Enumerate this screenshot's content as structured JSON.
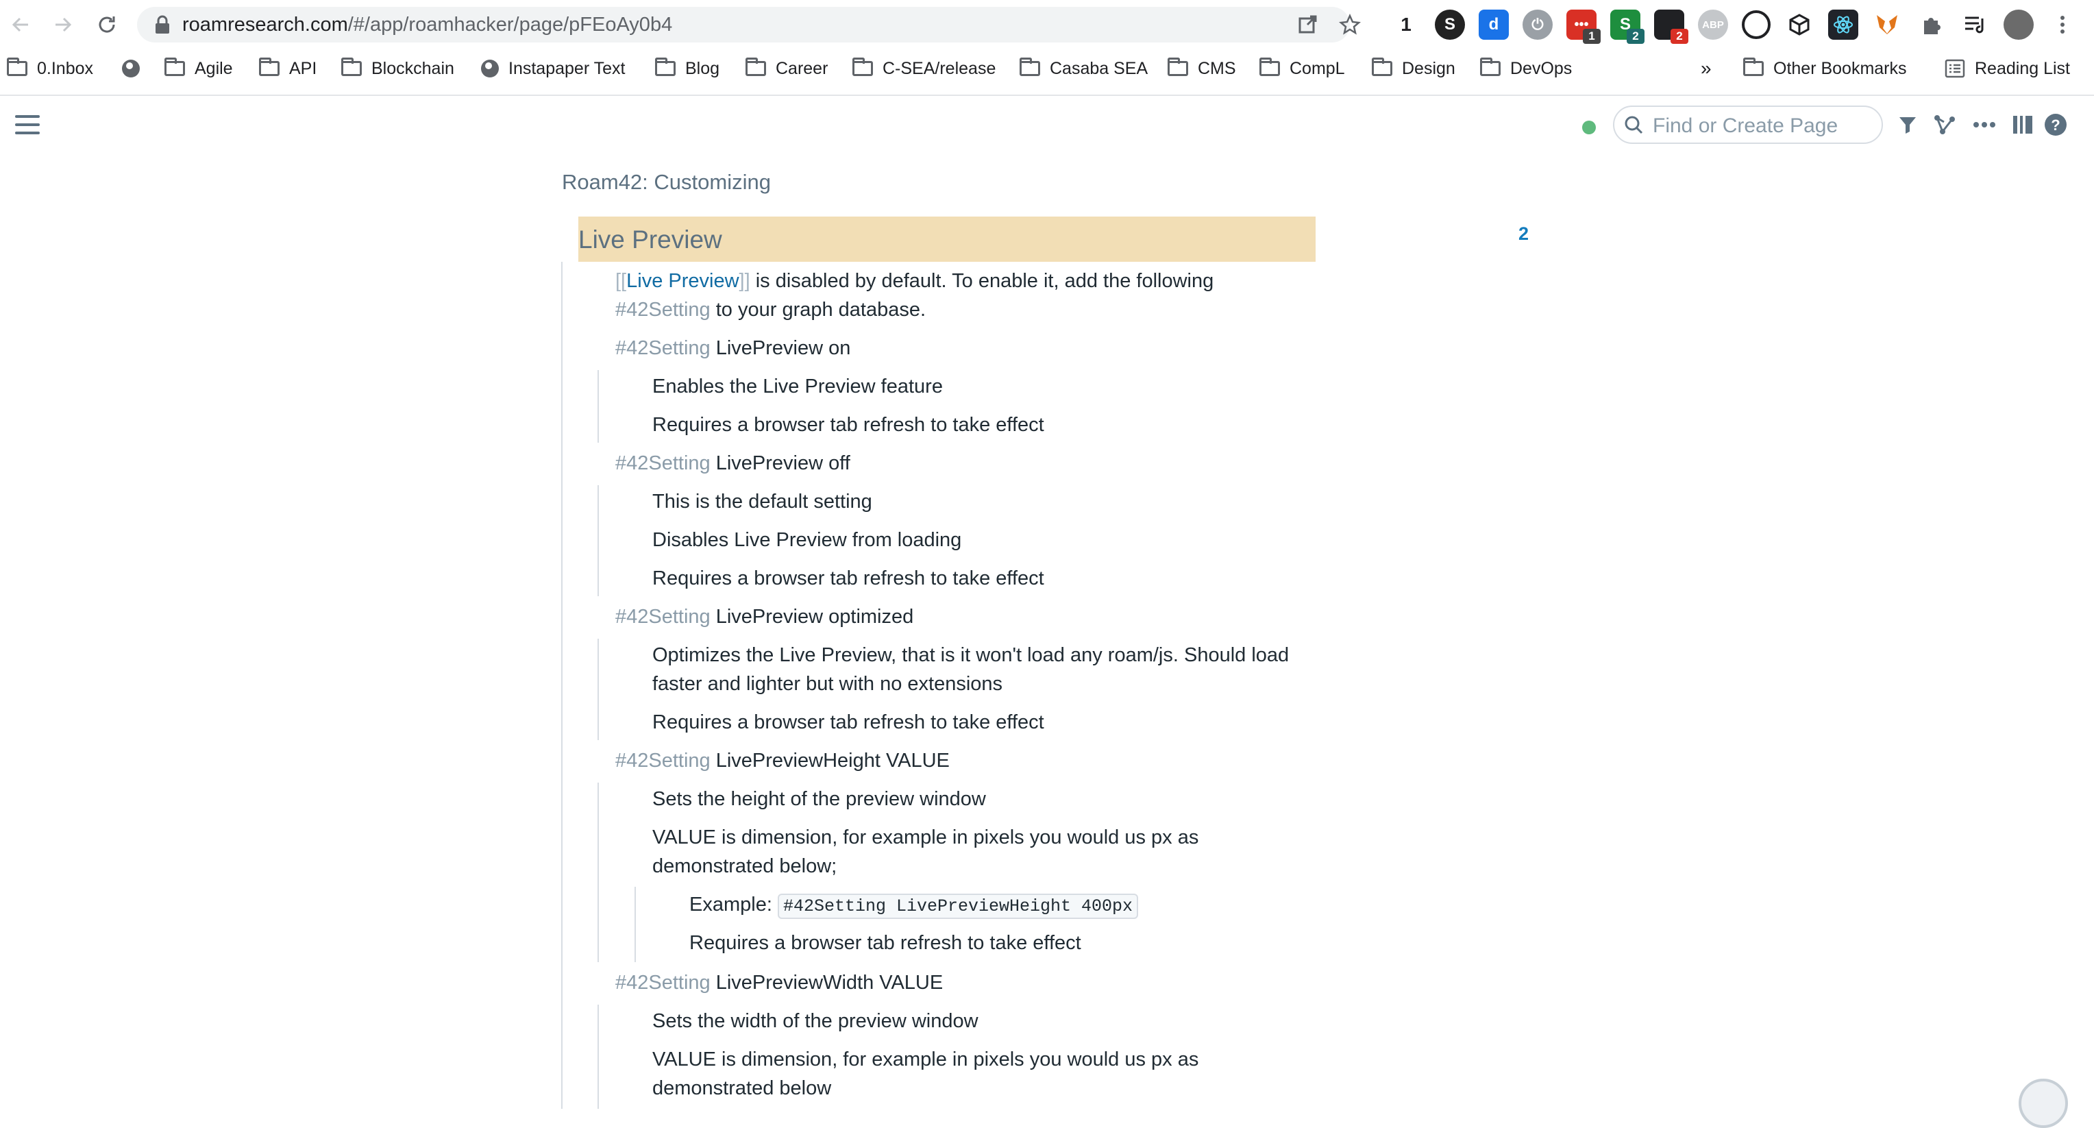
{
  "browser": {
    "url_host": "roamresearch.com",
    "url_path": "/#/app/roamhacker/page/pFEoAy0b4",
    "extensions": [
      {
        "name": "1password-ext",
        "text": "1",
        "badge": ""
      },
      {
        "name": "s-ext",
        "text": "S",
        "badge": ""
      },
      {
        "name": "d-ext",
        "text": "d",
        "badge": ""
      },
      {
        "name": "power-ext",
        "text": "",
        "badge": ""
      },
      {
        "name": "dots-ext",
        "text": "",
        "badge": "1"
      },
      {
        "name": "s2-ext",
        "text": "S",
        "badge": "2"
      },
      {
        "name": "dark-ext",
        "text": "",
        "badge": "2"
      },
      {
        "name": "abp-ext",
        "text": "ABP",
        "badge": ""
      }
    ],
    "bookmarks": [
      {
        "label": "0.Inbox",
        "icon": "folder"
      },
      {
        "label": "",
        "icon": "globe"
      },
      {
        "label": "Agile",
        "icon": "folder"
      },
      {
        "label": "API",
        "icon": "folder"
      },
      {
        "label": "Blockchain",
        "icon": "folder"
      },
      {
        "label": "Instapaper Text",
        "icon": "globe"
      },
      {
        "label": "Blog",
        "icon": "folder"
      },
      {
        "label": "Career",
        "icon": "folder"
      },
      {
        "label": "C-SEA/release",
        "icon": "folder"
      },
      {
        "label": "Casaba SEA",
        "icon": "folder"
      },
      {
        "label": "CMS",
        "icon": "folder"
      },
      {
        "label": "CompL",
        "icon": "folder"
      },
      {
        "label": "Design",
        "icon": "folder"
      },
      {
        "label": "DevOps",
        "icon": "folder"
      }
    ],
    "overflow": "»",
    "other_bookmarks": "Other Bookmarks",
    "reading_list": "Reading List"
  },
  "app": {
    "search_placeholder": "Find or Create Page"
  },
  "page": {
    "breadcrumb": "Roam42: Customizing",
    "title": "Live Preview",
    "reference_count": "2",
    "blocks": [
      {
        "text_pref_open": "[[",
        "text_pref": "Live Preview",
        "text_pref_close": "]]",
        "text_after": " is disabled by default. To enable it, add the following",
        "line2_tag": "#42Setting",
        "line2_rest": " to your graph database."
      },
      {
        "tag": "#42Setting",
        "rest": " LivePreview on"
      },
      {
        "text": "Enables the Live Preview feature"
      },
      {
        "text": "Requires a browser tab refresh to take effect"
      },
      {
        "tag": "#42Setting",
        "rest": " LivePreview off"
      },
      {
        "text": "This is the default setting"
      },
      {
        "text": "Disables Live Preview from loading"
      },
      {
        "text": "Requires a browser tab refresh to take effect"
      },
      {
        "tag": "#42Setting",
        "rest": " LivePreview optimized"
      },
      {
        "text": "Optimizes the Live Preview, that is it won't load any roam/js. Should load",
        "line2": "faster and lighter but with no extensions"
      },
      {
        "text": "Requires a browser tab refresh to take effect"
      },
      {
        "tag": "#42Setting",
        "rest": " LivePreviewHeight VALUE"
      },
      {
        "text": "Sets the height of the preview window"
      },
      {
        "text": "VALUE is dimension, for example in pixels you would us px as",
        "line2": "demonstrated below;"
      },
      {
        "text": "Example: ",
        "code": "#42Setting LivePreviewHeight 400px"
      },
      {
        "text": "Requires a browser tab refresh to take effect"
      },
      {
        "tag": "#42Setting",
        "rest": " LivePreviewWidth VALUE"
      },
      {
        "text": "Sets the width of the preview window"
      },
      {
        "text": "VALUE is dimension, for example in pixels you would us px as",
        "line2": "demonstrated below"
      }
    ]
  }
}
